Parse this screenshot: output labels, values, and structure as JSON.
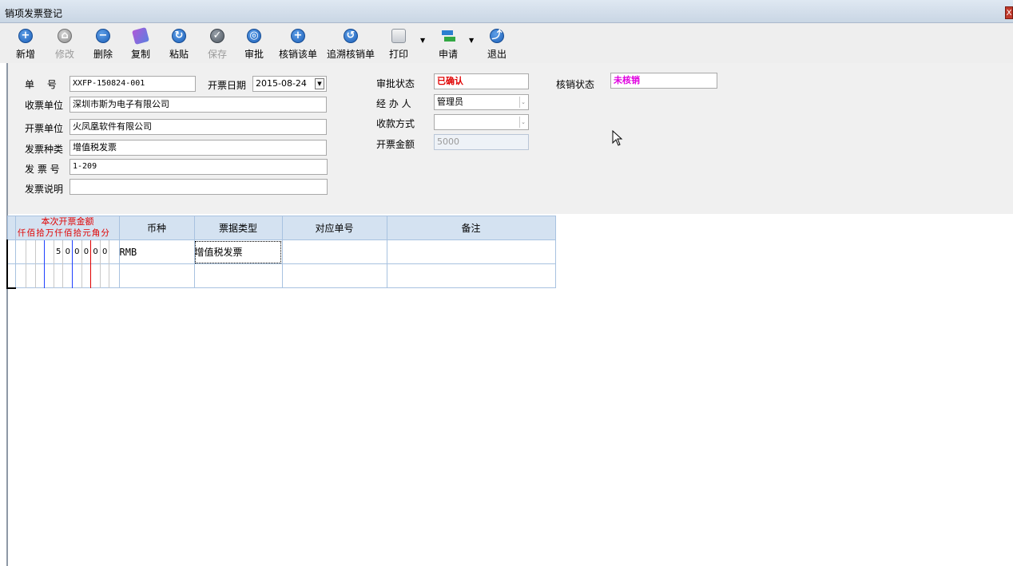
{
  "window": {
    "title": "销项发票登记",
    "close_label": "X"
  },
  "toolbar": {
    "buttons": [
      {
        "label": "新增",
        "icon": "plus-circle-icon",
        "enabled": true
      },
      {
        "label": "修改",
        "icon": "edit-circle-icon",
        "enabled": false
      },
      {
        "label": "删除",
        "icon": "minus-circle-icon",
        "enabled": true
      },
      {
        "label": "复制",
        "icon": "copy-icon",
        "enabled": true
      },
      {
        "label": "粘贴",
        "icon": "paste-circle-icon",
        "enabled": true
      },
      {
        "label": "保存",
        "icon": "check-circle-icon",
        "enabled": false
      },
      {
        "label": "审批",
        "icon": "approve-circle-icon",
        "enabled": true
      },
      {
        "label": "核销该单",
        "icon": "plus-circle-icon",
        "enabled": true
      },
      {
        "label": "追溯核销单",
        "icon": "trace-circle-icon",
        "enabled": true
      },
      {
        "label": "打印",
        "icon": "printer-icon",
        "enabled": true
      },
      {
        "label": "申请",
        "icon": "transfer-arrows-icon",
        "enabled": true
      },
      {
        "label": "退出",
        "icon": "exit-circle-icon",
        "enabled": true
      }
    ]
  },
  "form": {
    "bill_no": {
      "label": "单　 号",
      "value": "XXFP-150824-001"
    },
    "invoice_date": {
      "label": "开票日期",
      "value": "2015-08-24"
    },
    "receiving_unit": {
      "label": "收票单位",
      "value": "深圳市斯为电子有限公司"
    },
    "issuing_unit": {
      "label": "开票单位",
      "value": "火凤凰软件有限公司"
    },
    "invoice_type": {
      "label": "发票种类",
      "value": "增值税发票"
    },
    "invoice_no": {
      "label": "发 票 号",
      "value": "1-209"
    },
    "invoice_note": {
      "label": "发票说明",
      "value": ""
    },
    "approval_status": {
      "label": "审批状态",
      "value": "已确认",
      "color": "#e00000"
    },
    "handler": {
      "label": "经 办 人",
      "value": "管理员"
    },
    "payment_method": {
      "label": "收款方式",
      "value": ""
    },
    "invoice_amount": {
      "label": "开票金额",
      "value": "5000"
    },
    "writeoff_status": {
      "label": "核销状态",
      "value": "未核销",
      "color": "#e000e0"
    }
  },
  "grid": {
    "amount_header": "本次开票金额",
    "amount_units": [
      "仟",
      "佰",
      "拾",
      "万",
      "仟",
      "佰",
      "拾",
      "元",
      "角",
      "分"
    ],
    "columns": [
      "币种",
      "票据类型",
      "对应单号",
      "备注"
    ],
    "rows": [
      {
        "amount_digits": [
          "",
          "",
          "",
          "",
          "5",
          "0",
          "0",
          "0",
          "0",
          "0"
        ],
        "currency": "RMB",
        "doc_type": "增值税发票",
        "ref_no": "",
        "remark": ""
      },
      {
        "amount_digits": [
          "",
          "",
          "",
          "",
          "",
          "",
          "",
          "",
          "",
          ""
        ],
        "currency": "",
        "doc_type": "",
        "ref_no": "",
        "remark": ""
      }
    ]
  },
  "colors": {
    "accent_red": "#e00000",
    "accent_magenta": "#e000e0",
    "grid_header": "#d4e2f1"
  }
}
